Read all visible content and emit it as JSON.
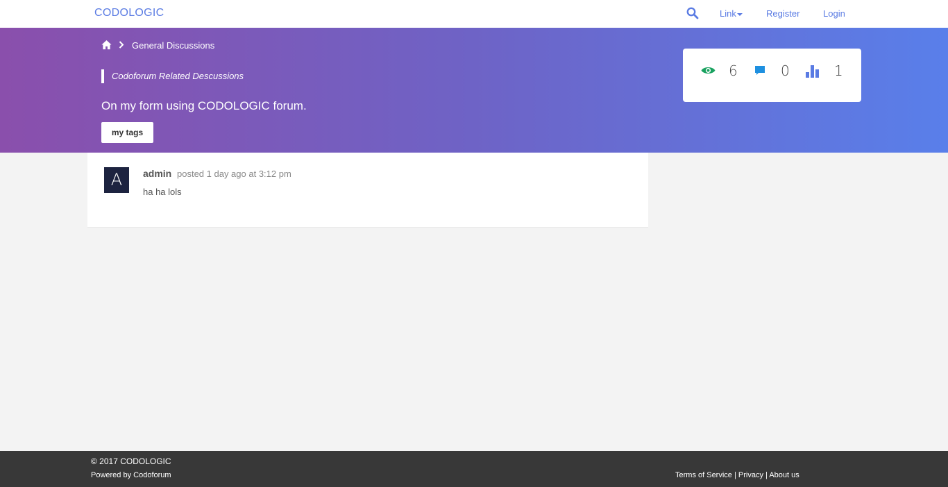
{
  "navbar": {
    "brand": "CODOLOGIC",
    "search_icon": "search-icon",
    "dropdown_label": "Link",
    "register_label": "Register",
    "login_label": "Login",
    "accent_color": "#5a7be3"
  },
  "hero": {
    "breadcrumb": {
      "home_icon": "home-icon",
      "separator_icon": "chevron-right-icon",
      "current": "General Discussions"
    },
    "category": "Codoforum Related Descussions",
    "topic_title": "On my form using CODOLOGIC forum.",
    "tags_button": "my tags",
    "gradient": [
      "#8a4fac",
      "#597fea"
    ],
    "stats": {
      "views": {
        "icon": "eye-icon",
        "value": "6",
        "color": "#1aa260"
      },
      "replies": {
        "icon": "comment-icon",
        "value": "0",
        "color": "#1e90e0"
      },
      "rank": {
        "icon": "bar-chart-icon",
        "value": "1",
        "color": "#5a7be3"
      }
    }
  },
  "post": {
    "avatar_letter": "A",
    "username": "admin",
    "meta": "posted 1 day ago at 3:12 pm",
    "body": "ha ha lols"
  },
  "footer": {
    "copyright": "© 2017 CODOLOGIC",
    "powered_prefix": "Powered by ",
    "powered_link": "Codoforum",
    "links": [
      "Terms of Service",
      "Privacy",
      "About us"
    ],
    "separator": " | "
  }
}
